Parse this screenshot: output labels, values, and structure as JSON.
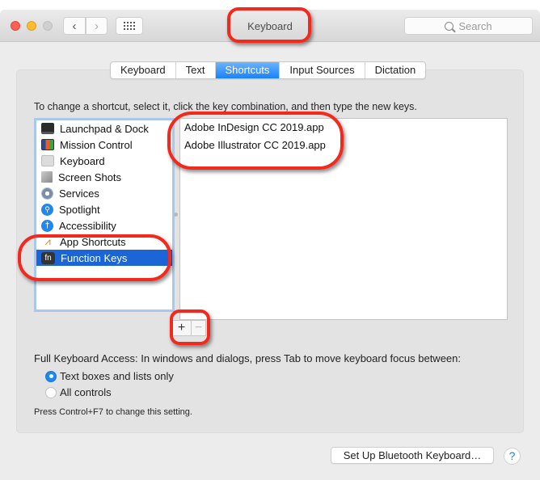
{
  "window": {
    "title": "Keyboard",
    "search_placeholder": "Search",
    "nav": {
      "back": "‹",
      "forward": "›"
    }
  },
  "tabs": [
    {
      "label": "Keyboard",
      "active": false
    },
    {
      "label": "Text",
      "active": false
    },
    {
      "label": "Shortcuts",
      "active": true
    },
    {
      "label": "Input Sources",
      "active": false
    },
    {
      "label": "Dictation",
      "active": false
    }
  ],
  "instruction": "To change a shortcut, select it, click the key combination, and then type the new keys.",
  "categories": [
    {
      "label": "Launchpad & Dock",
      "icon": "launchpad-icon",
      "glyph": ""
    },
    {
      "label": "Mission Control",
      "icon": "mission-control-icon",
      "glyph": ""
    },
    {
      "label": "Keyboard",
      "icon": "keyboard-icon",
      "glyph": ""
    },
    {
      "label": "Screen Shots",
      "icon": "screenshot-icon",
      "glyph": ""
    },
    {
      "label": "Services",
      "icon": "services-gear-icon",
      "glyph": ""
    },
    {
      "label": "Spotlight",
      "icon": "spotlight-icon",
      "glyph": "⚲"
    },
    {
      "label": "Accessibility",
      "icon": "accessibility-icon",
      "glyph": "†"
    },
    {
      "label": "App Shortcuts",
      "icon": "app-shortcuts-icon",
      "glyph": "⩘"
    },
    {
      "label": "Function Keys",
      "icon": "fn-icon",
      "glyph": "fn",
      "selected": true
    }
  ],
  "apps": [
    "Adobe InDesign CC 2019.app",
    "Adobe Illustrator CC 2019.app"
  ],
  "controls": {
    "add": "+",
    "remove": "−"
  },
  "full_keyboard_access": {
    "label": "Full Keyboard Access: In windows and dialogs, press Tab to move keyboard focus between:",
    "options": [
      {
        "label": "Text boxes and lists only",
        "checked": true
      },
      {
        "label": "All controls",
        "checked": false
      }
    ],
    "note": "Press Control+F7 to change this setting."
  },
  "footer": {
    "bluetooth_button": "Set Up Bluetooth Keyboard…",
    "help": "?"
  },
  "colors": {
    "accent": "#1a82fb",
    "selection": "#1b65d6",
    "annotation": "#f5281c"
  }
}
